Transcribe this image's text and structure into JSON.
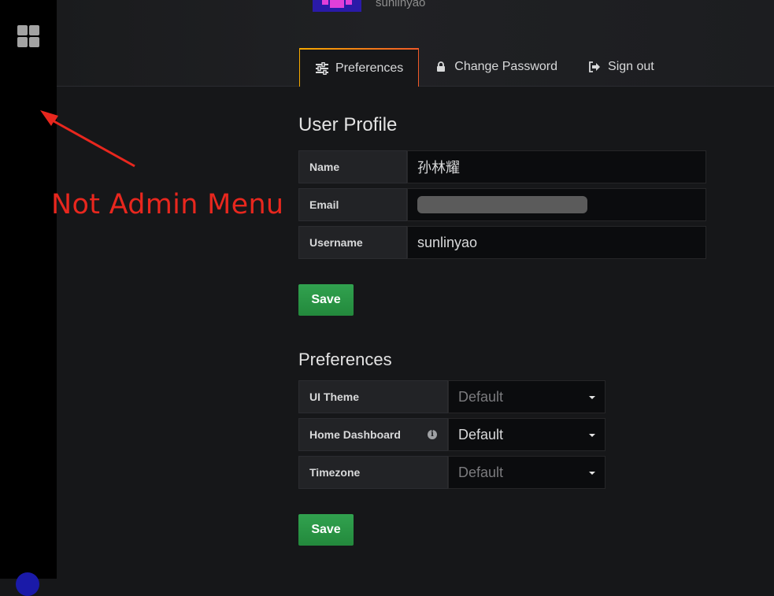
{
  "sidebar": {
    "apps_icon": "grid-icon",
    "avatar_icon": "user-avatar"
  },
  "header": {
    "username": "sunlinyao"
  },
  "tabs": [
    {
      "label": "Preferences",
      "icon": "sliders-icon",
      "active": true
    },
    {
      "label": "Change Password",
      "icon": "lock-icon",
      "active": false
    },
    {
      "label": "Sign out",
      "icon": "sign-out-icon",
      "active": false
    }
  ],
  "annotation": {
    "text": "Not Admin Menu",
    "color": "#e8271e"
  },
  "user_profile": {
    "title": "User Profile",
    "fields": {
      "name": {
        "label": "Name",
        "value": "孙林耀"
      },
      "email": {
        "label": "Email",
        "value": ""
      },
      "username": {
        "label": "Username",
        "value": "sunlinyao"
      }
    },
    "save_label": "Save"
  },
  "preferences": {
    "title": "Preferences",
    "ui_theme": {
      "label": "UI Theme",
      "value": "Default"
    },
    "home_dashboard": {
      "label": "Home Dashboard",
      "value": "Default",
      "info_icon": "info-icon"
    },
    "timezone": {
      "label": "Timezone",
      "value": "Default"
    },
    "save_label": "Save"
  },
  "colors": {
    "accent_gradient": [
      "#f7a900",
      "#f05a28"
    ],
    "save_button": "#299c46"
  }
}
